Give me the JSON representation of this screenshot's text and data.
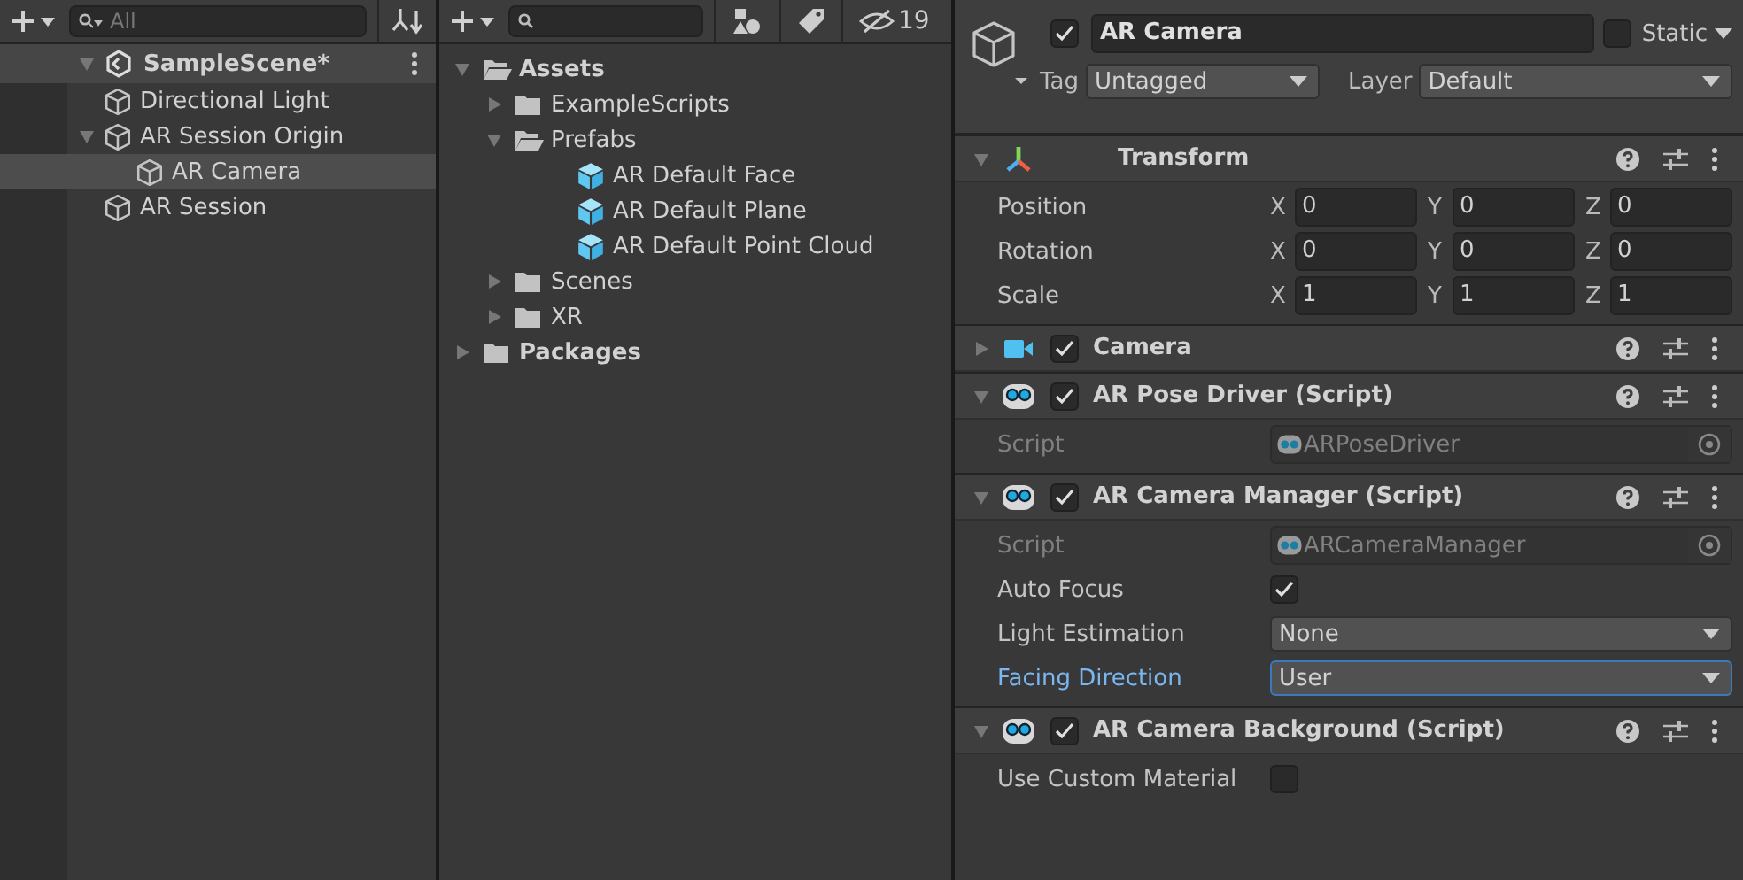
{
  "hierarchy": {
    "search": {
      "placeholder": "All"
    },
    "scene": {
      "name": "SampleScene*",
      "expanded": true
    },
    "items": [
      {
        "name": "Directional Light",
        "selected": false
      },
      {
        "name": "AR Session Origin",
        "selected": false,
        "expanded": true,
        "children": [
          {
            "name": "AR Camera",
            "selected": true
          }
        ]
      },
      {
        "name": "AR Session",
        "selected": false
      }
    ]
  },
  "project": {
    "hidden_count": "19",
    "tree": [
      {
        "name": "Assets",
        "kind": "folder",
        "bold": true,
        "expanded": true,
        "children": [
          {
            "name": "ExampleScripts",
            "kind": "folder",
            "expanded": false
          },
          {
            "name": "Prefabs",
            "kind": "folder",
            "expanded": true,
            "children": [
              {
                "name": "AR Default Face",
                "kind": "prefab"
              },
              {
                "name": "AR Default Plane",
                "kind": "prefab"
              },
              {
                "name": "AR Default Point Cloud",
                "kind": "prefab"
              }
            ]
          },
          {
            "name": "Scenes",
            "kind": "folder",
            "expanded": false
          },
          {
            "name": "XR",
            "kind": "folder",
            "expanded": false
          }
        ]
      },
      {
        "name": "Packages",
        "kind": "folder",
        "bold": true,
        "expanded": false
      }
    ]
  },
  "inspector": {
    "object": {
      "name": "AR Camera",
      "active": true,
      "static": false,
      "static_label": "Static",
      "tag_label": "Tag",
      "tag": "Untagged",
      "layer_label": "Layer",
      "layer": "Default"
    },
    "components": [
      {
        "name": "Transform",
        "kind": "transform",
        "expanded": true,
        "rows": [
          {
            "label": "Position",
            "values": [
              {
                "axis": "X",
                "value": "0"
              },
              {
                "axis": "Y",
                "value": "0"
              },
              {
                "axis": "Z",
                "value": "0"
              }
            ]
          },
          {
            "label": "Rotation",
            "values": [
              {
                "axis": "X",
                "value": "0"
              },
              {
                "axis": "Y",
                "value": "0"
              },
              {
                "axis": "Z",
                "value": "0"
              }
            ]
          },
          {
            "label": "Scale",
            "values": [
              {
                "axis": "X",
                "value": "1"
              },
              {
                "axis": "Y",
                "value": "1"
              },
              {
                "axis": "Z",
                "value": "1"
              }
            ]
          }
        ]
      },
      {
        "name": "Camera",
        "kind": "camera",
        "enabled": true,
        "expanded": false
      },
      {
        "name": "AR Pose Driver (Script)",
        "kind": "script",
        "enabled": true,
        "expanded": true,
        "properties": [
          {
            "label": "Script",
            "kind": "script",
            "value": "ARPoseDriver"
          }
        ]
      },
      {
        "name": "AR Camera Manager (Script)",
        "kind": "script",
        "enabled": true,
        "expanded": true,
        "properties": [
          {
            "label": "Script",
            "kind": "script",
            "value": "ARCameraManager"
          },
          {
            "label": "Auto Focus",
            "kind": "checkbox",
            "checked": true
          },
          {
            "label": "Light Estimation",
            "kind": "dropdown",
            "value": "None",
            "focused": false
          },
          {
            "label": "Facing Direction",
            "kind": "dropdown",
            "value": "User",
            "focused": true
          }
        ]
      },
      {
        "name": "AR Camera Background (Script)",
        "kind": "script",
        "enabled": true,
        "expanded": true,
        "properties": [
          {
            "label": "Use Custom Material",
            "kind": "checkbox",
            "checked": false
          }
        ]
      }
    ]
  }
}
